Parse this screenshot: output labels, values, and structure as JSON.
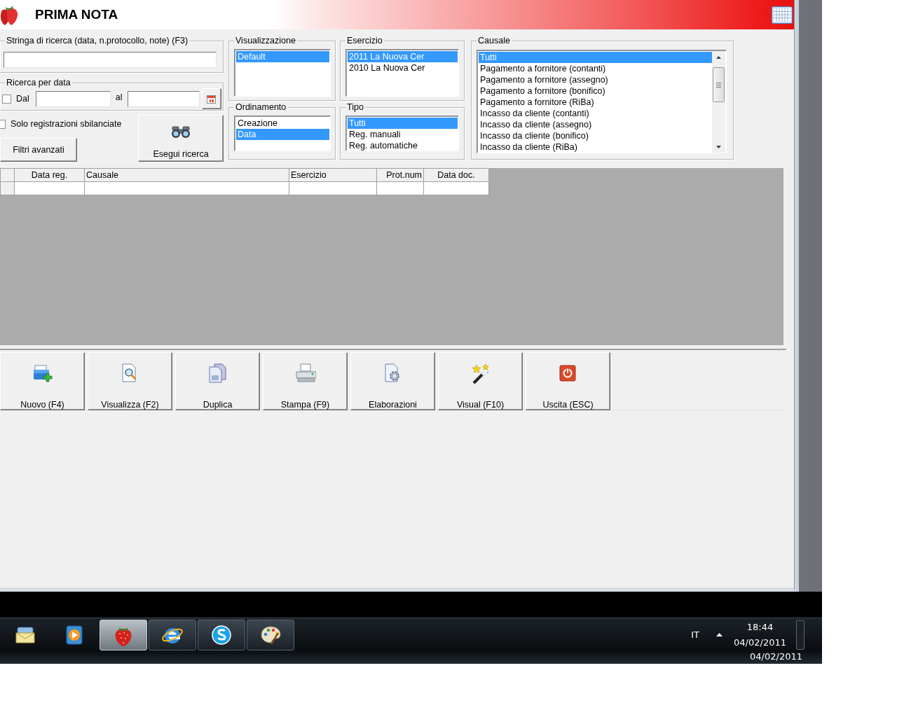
{
  "window": {
    "title": "PRIMA NOTA"
  },
  "search": {
    "label": "Stringa di ricerca (data, n.protocollo, note) (F3)"
  },
  "date_search": {
    "label": "Ricerca per data",
    "from_label": "Dal",
    "from_checked": false,
    "to_label": "al"
  },
  "unbalanced_only": {
    "label": "Solo registrazioni sbilanciate",
    "checked": false
  },
  "advanced_filters_button": "Filtri avanzati",
  "run_search_button": "Esegui ricerca",
  "visualizzazione": {
    "title": "Visualizzazione",
    "items": [
      {
        "label": "Default",
        "selected": true
      }
    ]
  },
  "esercizio": {
    "title": "Esercizio",
    "items": [
      {
        "label": "2011 La Nuova Cer",
        "selected": true
      },
      {
        "label": "2010 La Nuova Cer",
        "selected": false
      }
    ]
  },
  "ordinamento": {
    "title": "Ordinamento",
    "items": [
      {
        "label": "Creazione",
        "selected": false
      },
      {
        "label": "Data",
        "selected": true
      }
    ]
  },
  "tipo": {
    "title": "Tipo",
    "items": [
      {
        "label": "Tutti",
        "selected": true
      },
      {
        "label": "Reg. manuali",
        "selected": false
      },
      {
        "label": "Reg. automatiche",
        "selected": false
      }
    ]
  },
  "causale": {
    "title": "Causale",
    "items": [
      {
        "label": "Tutti",
        "selected": true
      },
      {
        "label": "Pagamento a fornitore (contanti)",
        "selected": false
      },
      {
        "label": "Pagamento a fornitore (assegno)",
        "selected": false
      },
      {
        "label": "Pagamento a fornitore (bonifico)",
        "selected": false
      },
      {
        "label": "Pagamento a fornitore (RiBa)",
        "selected": false
      },
      {
        "label": "Incasso da cliente (contanti)",
        "selected": false
      },
      {
        "label": "Incasso da cliente (assegno)",
        "selected": false
      },
      {
        "label": "Incasso da cliente (bonifico)",
        "selected": false
      },
      {
        "label": "Incasso da cliente (RiBa)",
        "selected": false
      }
    ]
  },
  "table": {
    "columns": [
      "Data reg.",
      "Causale",
      "Esercizio",
      "Prot.num",
      "Data doc."
    ]
  },
  "toolbar": [
    {
      "kind": "new",
      "label": "Nuovo (F4)"
    },
    {
      "kind": "view",
      "label": "Visualizza (F2)"
    },
    {
      "kind": "duplicate",
      "label": "Duplica"
    },
    {
      "kind": "print",
      "label": "Stampa (F9)"
    },
    {
      "kind": "process",
      "label": "Elaborazioni"
    },
    {
      "kind": "visual",
      "label": "Visual (F10)"
    },
    {
      "kind": "exit",
      "label": "Uscita (ESC)"
    }
  ],
  "taskbar": {
    "apps": [
      {
        "kind": "mail",
        "running": false,
        "selected": false
      },
      {
        "kind": "media",
        "running": false,
        "selected": false
      },
      {
        "kind": "strawberry",
        "running": true,
        "selected": true
      },
      {
        "kind": "browser",
        "running": true,
        "selected": false
      },
      {
        "kind": "chat",
        "running": true,
        "selected": false
      },
      {
        "kind": "paint",
        "running": true,
        "selected": false
      }
    ],
    "language": "IT",
    "time": "18:44",
    "date": "04/02/2011",
    "date_reflection": "04/02/2011"
  }
}
